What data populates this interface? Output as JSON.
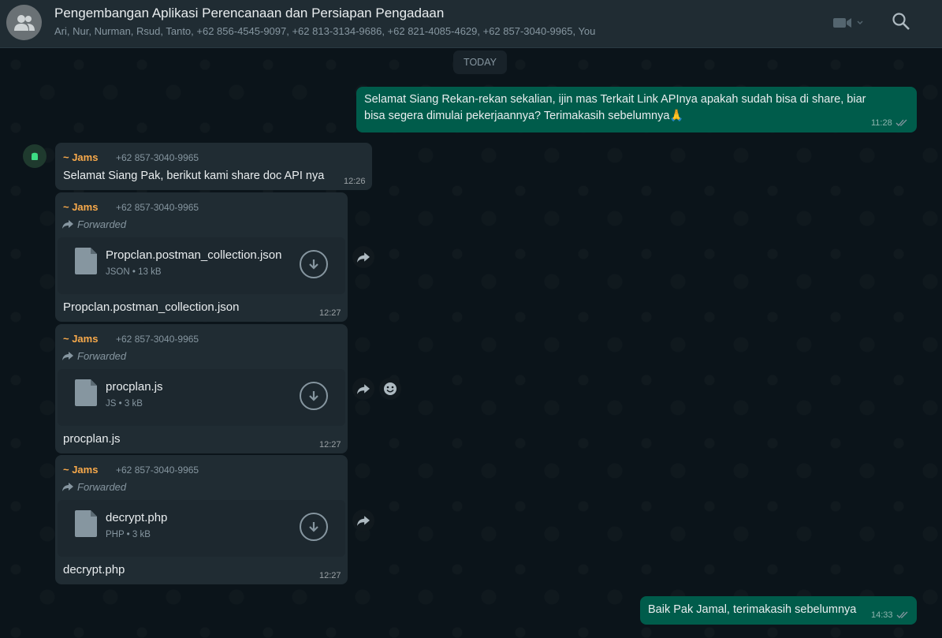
{
  "header": {
    "title": "Pengembangan Aplikasi Perencanaan dan Persiapan Pengadaan",
    "participants": "Ari, Nur, Nurman, Rsud, Tanto, +62 856-4545-9097, +62 813-3134-9686, +62 821-4085-4629, +62 857-3040-9965, You",
    "avatar_icon": "group-icon",
    "video_icon": "video-call-icon",
    "search_icon": "search-icon"
  },
  "chat": {
    "date_divider": "TODAY",
    "messages": [
      {
        "type": "outgoing-text",
        "text_line1": "Selamat Siang Rekan-rekan sekalian, ijin mas Terkait Link APInya apakah sudah bisa di share, biar",
        "text_line2": "bisa segera dimulai pekerjaannya? Terimakasih sebelumnya🙏",
        "time": "11:28",
        "status_icon": "double-check-icon"
      },
      {
        "type": "incoming-text",
        "sender": "~ Jams",
        "phone": "+62 857-3040-9965",
        "text": "Selamat Siang Pak, berikut kami share doc API nya",
        "time": "12:26"
      },
      {
        "type": "incoming-file",
        "sender": "~ Jams",
        "phone": "+62 857-3040-9965",
        "forwarded_label": "Forwarded",
        "file_name": "Propclan.postman_collection.json",
        "file_type": "JSON",
        "file_size": "13 kB",
        "caption": "Propclan.postman_collection.json",
        "time": "12:27"
      },
      {
        "type": "incoming-file",
        "sender": "~ Jams",
        "phone": "+62 857-3040-9965",
        "forwarded_label": "Forwarded",
        "file_name": "procplan.js",
        "file_type": "JS",
        "file_size": "3 kB",
        "caption": "procplan.js",
        "time": "12:27"
      },
      {
        "type": "incoming-file",
        "sender": "~ Jams",
        "phone": "+62 857-3040-9965",
        "forwarded_label": "Forwarded",
        "file_name": "decrypt.php",
        "file_type": "PHP",
        "file_size": "3 kB",
        "caption": "decrypt.php",
        "time": "12:27"
      },
      {
        "type": "outgoing-text",
        "text": "Baik Pak Jamal, terimakasih sebelumnya",
        "time": "14:33",
        "status_icon": "double-check-icon"
      }
    ]
  },
  "colors": {
    "outgoing_bubble": "#005c4b",
    "incoming_bubble": "#202c33",
    "sender_name": "#f7a94b",
    "background": "#0b141a"
  }
}
